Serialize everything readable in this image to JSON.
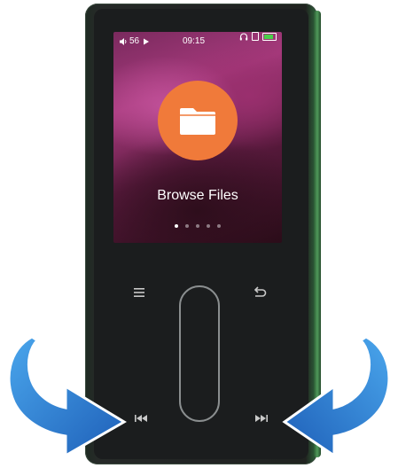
{
  "status_bar": {
    "volume": "56",
    "time": "09:15",
    "battery_level": 0.85
  },
  "app": {
    "label": "Browse Files",
    "icon": "folder-icon",
    "page_count": 5,
    "active_page": 1
  },
  "controls": {
    "menu_icon": "menu-icon",
    "back_icon": "back-icon",
    "prev_icon": "previous-track-icon",
    "next_icon": "next-track-icon"
  },
  "colors": {
    "folder_circle": "#f07a3a",
    "arrow_blue": "#1e74c8",
    "device_green": "#2f6b3d"
  }
}
